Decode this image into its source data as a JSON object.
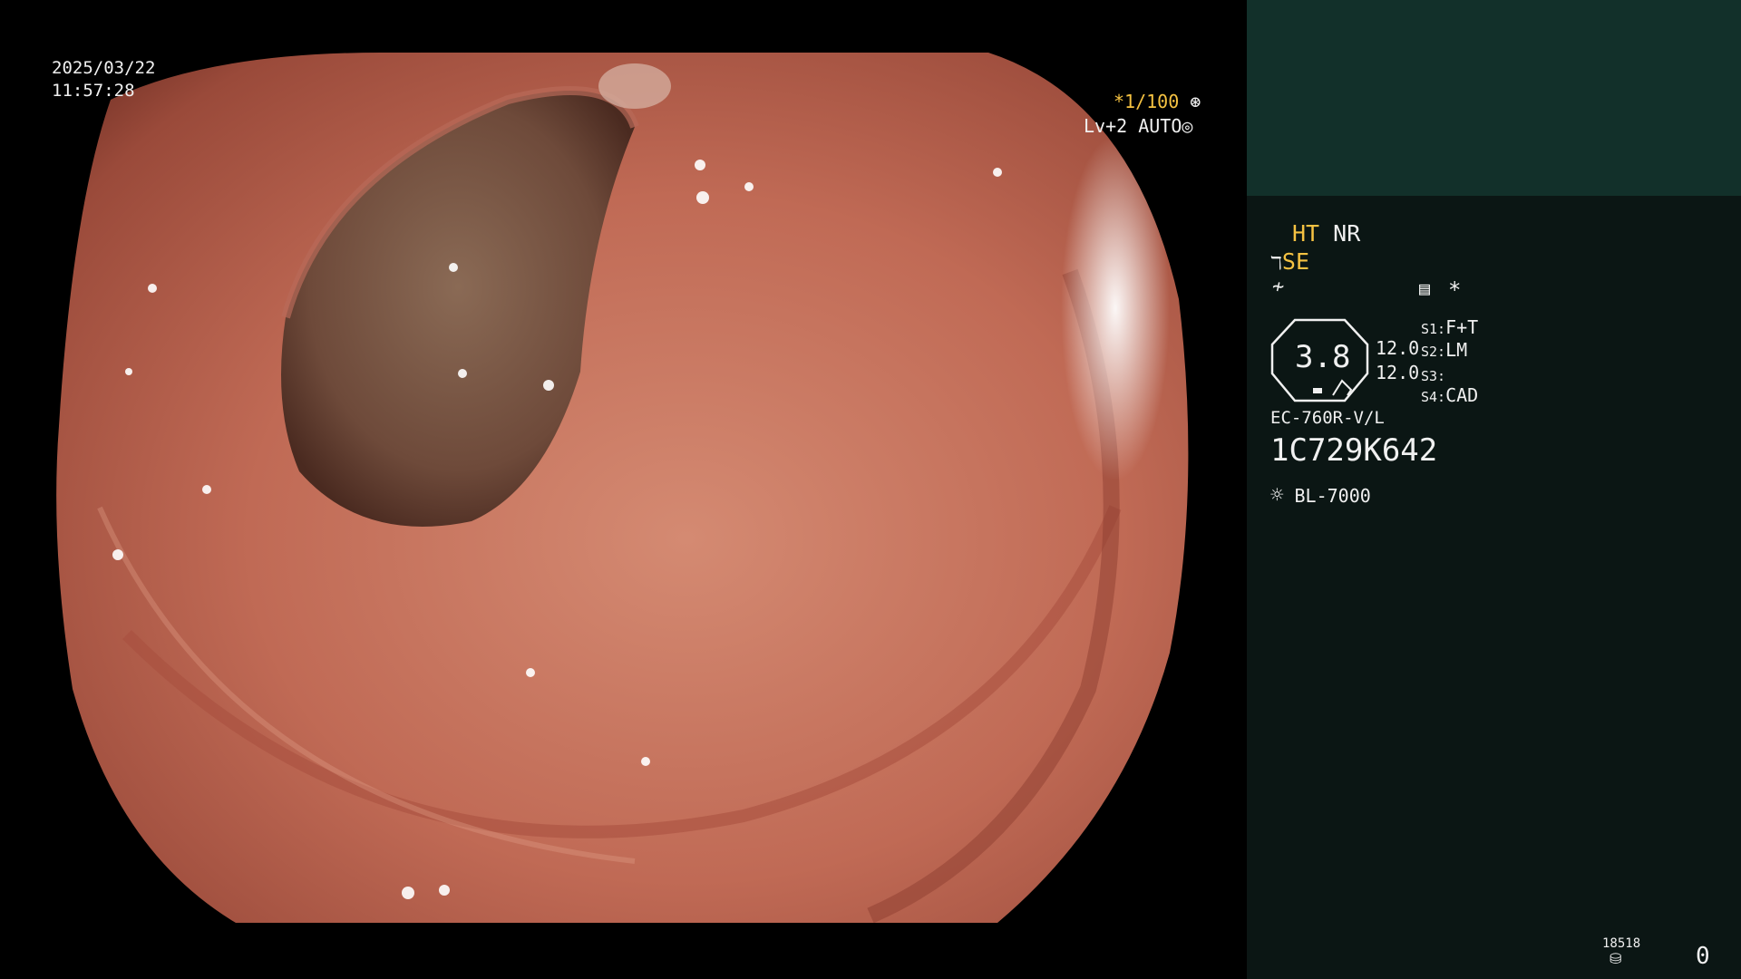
{
  "overlay": {
    "date": "2025/03/22",
    "time": "11:57:28",
    "shutter": "*1/100",
    "level": "Lv+2",
    "iris": "AUTO"
  },
  "panel": {
    "ht": "HT",
    "nr": "NR",
    "se": "SE",
    "star": "*",
    "zoom": "3.8",
    "value1": "12.0",
    "value2": "12.0",
    "switches": [
      {
        "key": "S1:",
        "value": "F+T"
      },
      {
        "key": "S2:",
        "value": "LM"
      },
      {
        "key": "S3:",
        "value": ""
      },
      {
        "key": "S4:",
        "value": "CAD"
      }
    ],
    "scope_model": "EC-760R-V/L",
    "serial": "1C729K642",
    "light_source": "BL-7000",
    "counter": "18518",
    "count": "0"
  },
  "colors": {
    "panel_bg": "#0b1614",
    "panel_top": "#12302a",
    "accent_yellow": "#f5c242"
  }
}
